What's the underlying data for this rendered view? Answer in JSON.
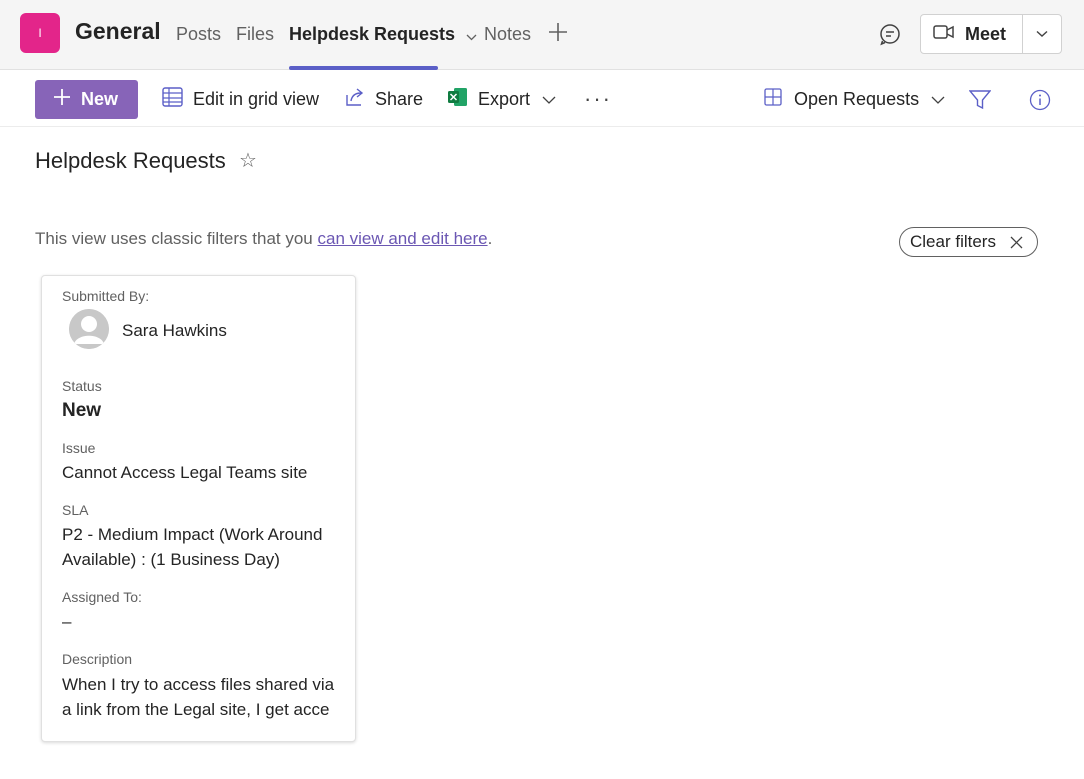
{
  "header": {
    "team_initial": "I",
    "channel_name": "General",
    "tabs": [
      {
        "label": "Posts"
      },
      {
        "label": "Files"
      },
      {
        "label": "Helpdesk Requests"
      },
      {
        "label": "Notes"
      }
    ],
    "meet_label": "Meet",
    "accent_color": "#5b5fc7",
    "team_color": "#e3258a"
  },
  "toolbar": {
    "new_label": "New",
    "edit_grid_label": "Edit in grid view",
    "share_label": "Share",
    "export_label": "Export",
    "more_label": "···",
    "view_label": "Open Requests",
    "new_button_color": "#8764b8"
  },
  "page": {
    "title": "Helpdesk Requests",
    "notice_text": "This view uses classic filters that you ",
    "notice_link": "can view and edit here",
    "notice_end": ".",
    "clear_filters_label": "Clear filters"
  },
  "card": {
    "submitted_by_label": "Submitted By:",
    "submitted_by": "Sara Hawkins",
    "status_label": "Status",
    "status": "New",
    "issue_label": "Issue",
    "issue": "Cannot Access Legal Teams site",
    "sla_label": "SLA",
    "sla_line1": "P2 - Medium Impact (Work Around",
    "sla_line2": "Available) : (1 Business Day)",
    "assigned_label": "Assigned To:",
    "assigned": "–",
    "description_label": "Description",
    "description_line1": "When I try to access files shared via",
    "description_line2": "a link from the Legal site, I get acce"
  }
}
